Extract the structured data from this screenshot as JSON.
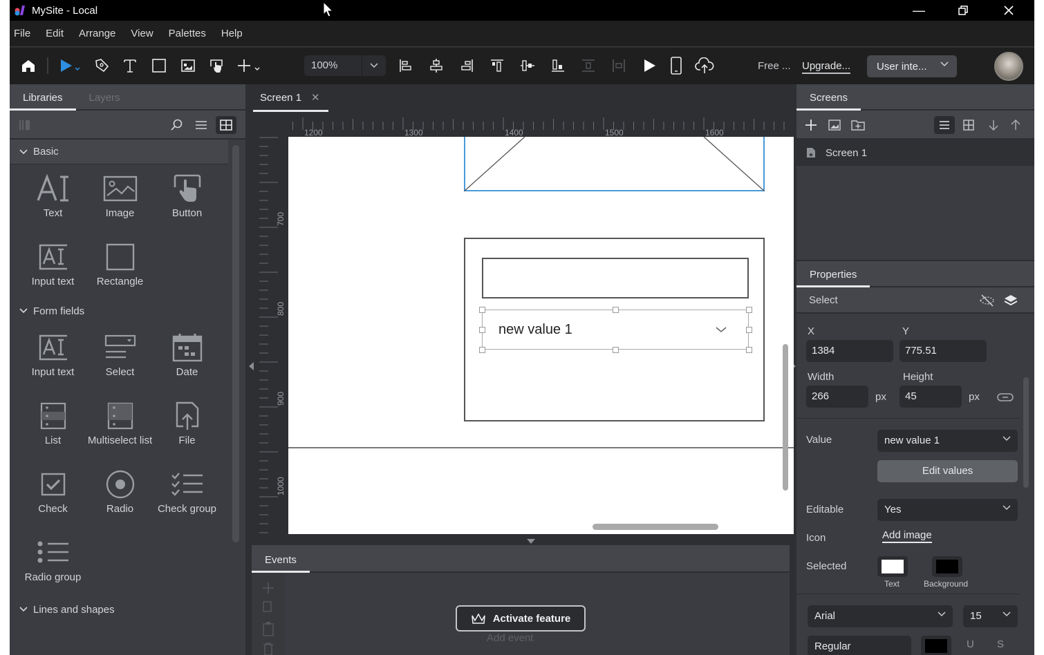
{
  "window": {
    "title": "MySite - Local",
    "controls": {
      "minimize": "minimize-icon",
      "restore": "restore-icon",
      "close": "close-icon"
    }
  },
  "menu": [
    "File",
    "Edit",
    "Arrange",
    "View",
    "Palettes",
    "Help"
  ],
  "toolbar": {
    "zoom": "100%",
    "plan_label": "Free ...",
    "upgrade_label": "Upgrade...",
    "project_select": "User inte...",
    "tools": [
      "home-icon",
      "select-arrow-icon",
      "pen-icon",
      "text-icon",
      "rectangle-icon",
      "image-icon",
      "button-hand-icon",
      "add-icon",
      "align-left-icon",
      "align-center-icon",
      "align-right-icon",
      "align-top-icon",
      "align-middle-icon",
      "align-bottom-icon",
      "distribute-vertical-icon",
      "distribute-horizontal-icon",
      "play-icon",
      "device-icon",
      "upload-cloud-icon"
    ]
  },
  "left_panel": {
    "tabs": [
      "Libraries",
      "Layers"
    ],
    "active_tab": "Libraries",
    "sections": [
      {
        "title": "Basic",
        "items": [
          {
            "label": "Text",
            "icon": "text-ai-icon"
          },
          {
            "label": "Image",
            "icon": "image-icon"
          },
          {
            "label": "Button",
            "icon": "button-hand-icon"
          },
          {
            "label": "Input text",
            "icon": "input-text-icon"
          },
          {
            "label": "Rectangle",
            "icon": "rectangle-icon"
          }
        ]
      },
      {
        "title": "Form fields",
        "items": [
          {
            "label": "Input text",
            "icon": "input-text-icon"
          },
          {
            "label": "Select",
            "icon": "select-icon"
          },
          {
            "label": "Date",
            "icon": "calendar-icon"
          },
          {
            "label": "List",
            "icon": "list-icon"
          },
          {
            "label": "Multiselect list",
            "icon": "multiselect-list-icon"
          },
          {
            "label": "File",
            "icon": "file-upload-icon"
          },
          {
            "label": "Check",
            "icon": "checkbox-icon"
          },
          {
            "label": "Radio",
            "icon": "radio-icon"
          },
          {
            "label": "Check group",
            "icon": "check-group-icon"
          },
          {
            "label": "Radio group",
            "icon": "radio-group-icon"
          }
        ]
      },
      {
        "title": "Lines and shapes",
        "items": []
      }
    ]
  },
  "document_tab": {
    "label": "Screen 1"
  },
  "rulers": {
    "horizontal": [
      "1200",
      "1300",
      "1400",
      "1500",
      "1600"
    ],
    "vertical": [
      "700",
      "800",
      "900",
      "1000"
    ]
  },
  "canvas": {
    "select_widget_value": "new value 1"
  },
  "events_panel": {
    "tab": "Events",
    "activate_label": "Activate feature",
    "add_event_label": "Add event"
  },
  "screens_panel": {
    "tab": "Screens",
    "screens": [
      "Screen 1"
    ]
  },
  "properties": {
    "tab": "Properties",
    "element_type": "Select",
    "x_label": "X",
    "x": "1384",
    "y_label": "Y",
    "y": "775.51",
    "width_label": "Width",
    "width": "266",
    "height_label": "Height",
    "height": "45",
    "unit": "px",
    "value_label": "Value",
    "value": "new value 1",
    "edit_values_label": "Edit values",
    "editable_label": "Editable",
    "editable": "Yes",
    "icon_label": "Icon",
    "add_image_label": "Add image",
    "selected_label": "Selected",
    "selected_text_label": "Text",
    "selected_text_color": "#ffffff",
    "selected_bg_label": "Background",
    "selected_bg_color": "#000000",
    "font": "Arial",
    "font_size": "15",
    "font_style": "Regular"
  },
  "colors": {
    "accent_blue": "#2f8fe0",
    "selection_blue": "#4a9ad8"
  }
}
